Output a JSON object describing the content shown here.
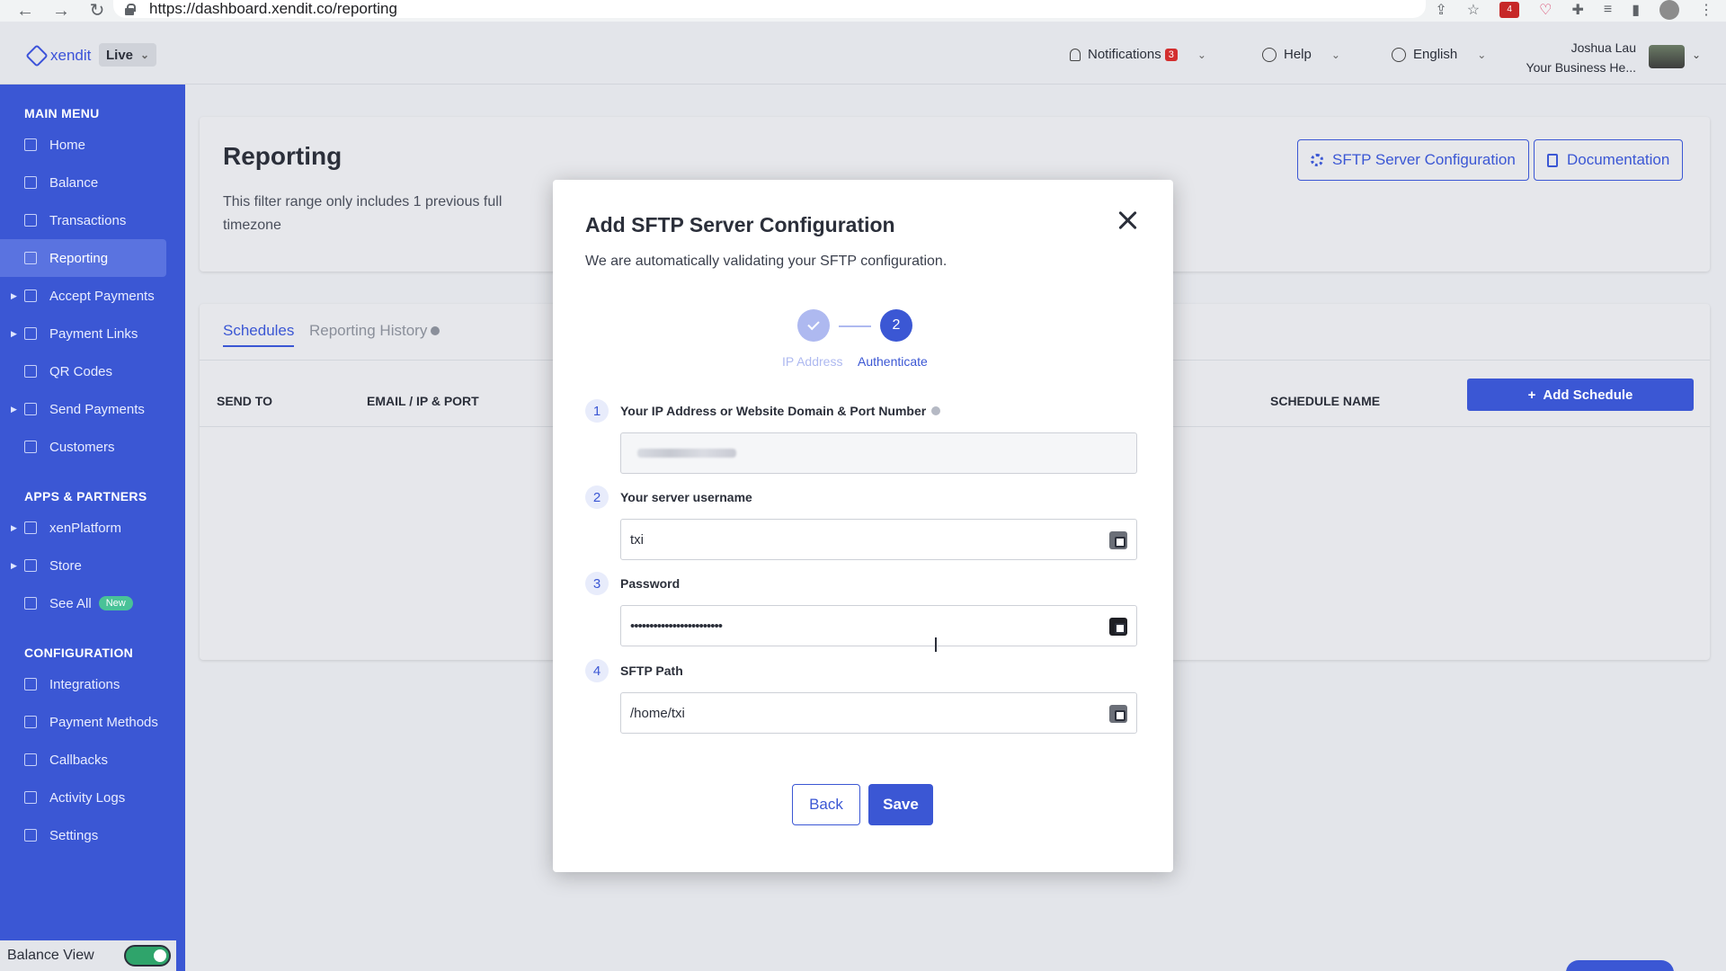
{
  "browser": {
    "url": "https://dashboard.xendit.co/reporting",
    "ext_badge": "4"
  },
  "header": {
    "logo_text": "xendit",
    "env": "Live",
    "notifications_label": "Notifications",
    "notifications_count": "3",
    "help_label": "Help",
    "language_label": "English",
    "user_name": "Joshua Lau",
    "business_name": "Your Business He..."
  },
  "sidebar": {
    "main_menu_title": "MAIN MENU",
    "main_items": [
      {
        "label": "Home",
        "icon": "home-icon"
      },
      {
        "label": "Balance",
        "icon": "balance-icon"
      },
      {
        "label": "Transactions",
        "icon": "transactions-icon"
      },
      {
        "label": "Reporting",
        "icon": "reporting-icon",
        "active": true
      },
      {
        "label": "Accept Payments",
        "icon": "accept-payments-icon"
      },
      {
        "label": "Payment Links",
        "icon": "payment-links-icon"
      },
      {
        "label": "QR Codes",
        "icon": "qr-code-icon"
      },
      {
        "label": "Send Payments",
        "icon": "send-payments-icon"
      },
      {
        "label": "Customers",
        "icon": "customers-icon"
      }
    ],
    "apps_title": "APPS & PARTNERS",
    "apps_items": [
      {
        "label": "xenPlatform",
        "icon": "xenplatform-icon"
      },
      {
        "label": "Store",
        "icon": "store-icon"
      },
      {
        "label": "See All",
        "icon": "grid-icon",
        "badge": "New"
      }
    ],
    "config_title": "CONFIGURATION",
    "config_items": [
      {
        "label": "Integrations",
        "icon": "integrations-icon"
      },
      {
        "label": "Payment Methods",
        "icon": "payment-methods-icon"
      },
      {
        "label": "Callbacks",
        "icon": "callbacks-icon"
      },
      {
        "label": "Activity Logs",
        "icon": "activity-logs-icon"
      },
      {
        "label": "Settings",
        "icon": "settings-icon"
      }
    ],
    "balance_view_label": "Balance View"
  },
  "page": {
    "title": "Reporting",
    "description": "This filter range only includes 1 previous full timezone",
    "sftp_button": "SFTP Server Configuration",
    "documentation_button": "Documentation",
    "tabs": [
      "Schedules",
      "Reporting History"
    ],
    "table_headers": [
      "SEND TO",
      "EMAIL / IP & PORT",
      "SCHEDULE NAME"
    ],
    "add_schedule_button": "Add Schedule"
  },
  "modal": {
    "title": "Add SFTP Server Configuration",
    "subtitle": "We are automatically validating your SFTP configuration.",
    "steps": [
      {
        "label": "IP Address",
        "state": "done"
      },
      {
        "label": "Authenticate",
        "state": "current",
        "number": "2"
      }
    ],
    "fields": [
      {
        "number": "1",
        "label": "Your IP Address or Website Domain & Port Number",
        "value": "",
        "placeholder": ""
      },
      {
        "number": "2",
        "label": "Your server username",
        "value": "txi"
      },
      {
        "number": "3",
        "label": "Password",
        "value": "••••••••••••••••••••••••"
      },
      {
        "number": "4",
        "label": "SFTP Path",
        "value": "/home/txi"
      }
    ],
    "back_button": "Back",
    "save_button": "Save"
  },
  "colors": {
    "brand": "#3b57d4",
    "sidebar_active": "#5a73e0",
    "badge_new": "#49c297",
    "notification_badge": "#d32f2f"
  }
}
